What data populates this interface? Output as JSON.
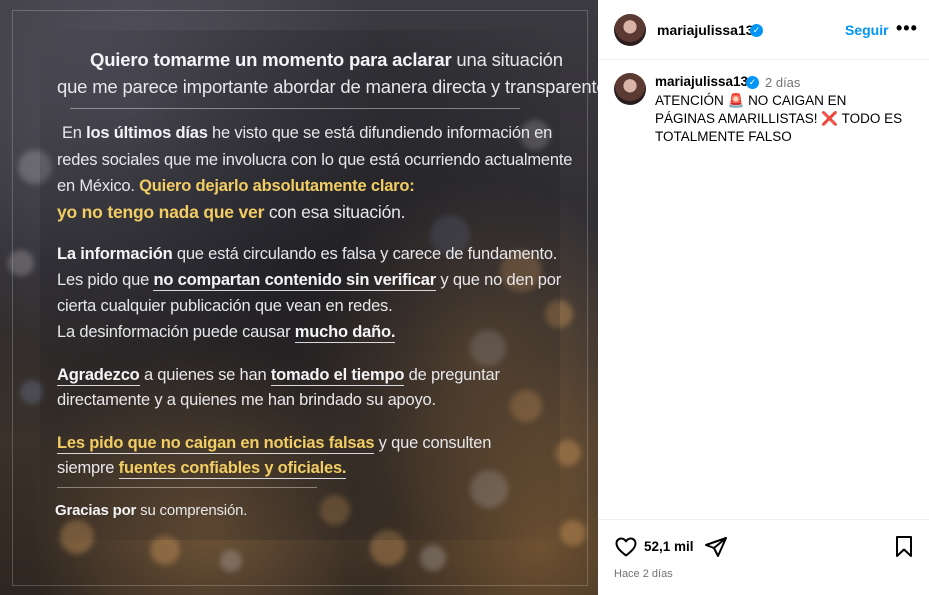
{
  "post_image": {
    "line1": {
      "a": "Quiero tomarme un momento para aclarar",
      "b": " una situación"
    },
    "line2": "que me parece importante abordar de manera directa y transparente.",
    "line3": {
      "a": "En ",
      "b": "los últimos días",
      "c": " he visto que se está difundiendo información en"
    },
    "line4": "redes sociales que me involucra con lo que está ocurriendo actualmente",
    "line5": {
      "a": "en México. ",
      "b": "Quiero dejarlo absolutamente claro:"
    },
    "line6": {
      "a": "yo no tengo nada que ver",
      "b": " con esa situación."
    },
    "line7": {
      "a": "La información",
      "b": " que está circulando es falsa y carece de fundamento."
    },
    "line8": {
      "a": "Les pido que ",
      "b": "no compartan contenido sin verificar",
      "c": " y que no den por"
    },
    "line9": "cierta cualquier publicación que vean en redes.",
    "line10": {
      "a": "La desinformación puede causar ",
      "b": "mucho daño."
    },
    "line11": {
      "a": "Agradezco",
      "b": " a quienes se han ",
      "c": "tomado el tiempo",
      "d": " de preguntar"
    },
    "line12": "directamente y a quienes me han brindado su apoyo.",
    "line13": {
      "a": "Les pido que no caigan en noticias falsas",
      "b": " y que consulten"
    },
    "line14": {
      "a": "siempre ",
      "b": "fuentes confiables y oficiales."
    },
    "line15": {
      "a": "Gracias por",
      "b": " su comprensión."
    }
  },
  "header": {
    "username": "mariajulissa13",
    "verified_mark": "✓",
    "follow_label": "Seguir",
    "more_label": "•••"
  },
  "comment": {
    "username": "mariajulissa13",
    "verified_mark": "✓",
    "time": "2 días",
    "text": "ATENCIÓN 🚨 NO CAIGAN EN PÁGINAS AMARILLISTAS! ❌ TODO ES TOTALMENTE FALSO"
  },
  "actions": {
    "likes": "52,1 mil",
    "posted_ago": "Hace 2 días"
  },
  "icons": {
    "verified": "verified-badge-icon",
    "like": "heart-icon",
    "share": "paper-plane-icon",
    "save": "bookmark-icon",
    "more": "more-options-icon"
  },
  "colors": {
    "link_blue": "#0095f6",
    "highlight_yellow": "#f2cd63",
    "muted_gray": "#737373"
  }
}
